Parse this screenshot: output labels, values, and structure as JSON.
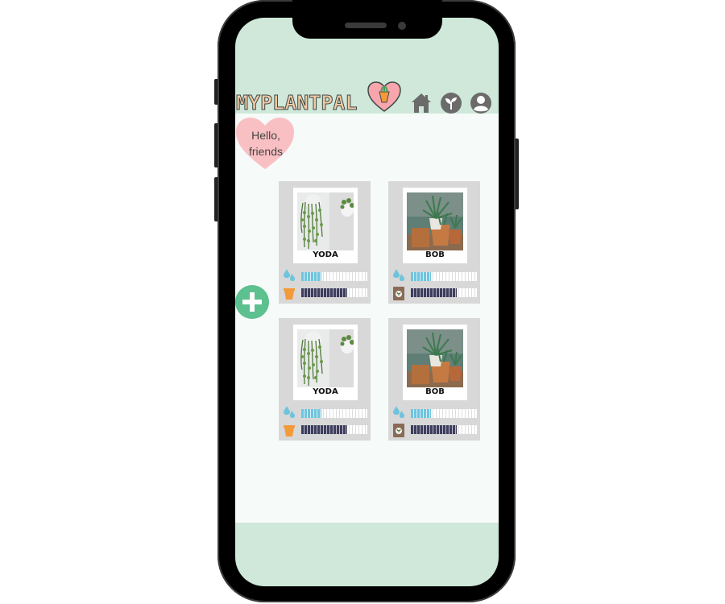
{
  "app": {
    "title": "MYPLANTPAL",
    "colors": {
      "mint": "#cfe8da",
      "heart": "#f7a6ad",
      "green_button": "#5cc08f",
      "icon_gray": "#6b6b6b"
    }
  },
  "nav": {
    "icons": [
      "home-icon",
      "plant-icon",
      "profile-icon"
    ]
  },
  "greeting": {
    "line1": "Hello,",
    "line2": "friends"
  },
  "plants": [
    {
      "name": "YODA",
      "photo": "hanging-plant",
      "water_level": 0.3,
      "food_level": 0.7,
      "food_icon": "pot-icon"
    },
    {
      "name": "BOB",
      "photo": "potted-plant",
      "water_level": 0.3,
      "food_level": 0.7,
      "food_icon": "soil-bag-icon"
    },
    {
      "name": "YODA",
      "photo": "hanging-plant",
      "water_level": 0.3,
      "food_level": 0.7,
      "food_icon": "pot-icon"
    },
    {
      "name": "BOB",
      "photo": "potted-plant",
      "water_level": 0.3,
      "food_level": 0.7,
      "food_icon": "soil-bag-icon"
    }
  ]
}
